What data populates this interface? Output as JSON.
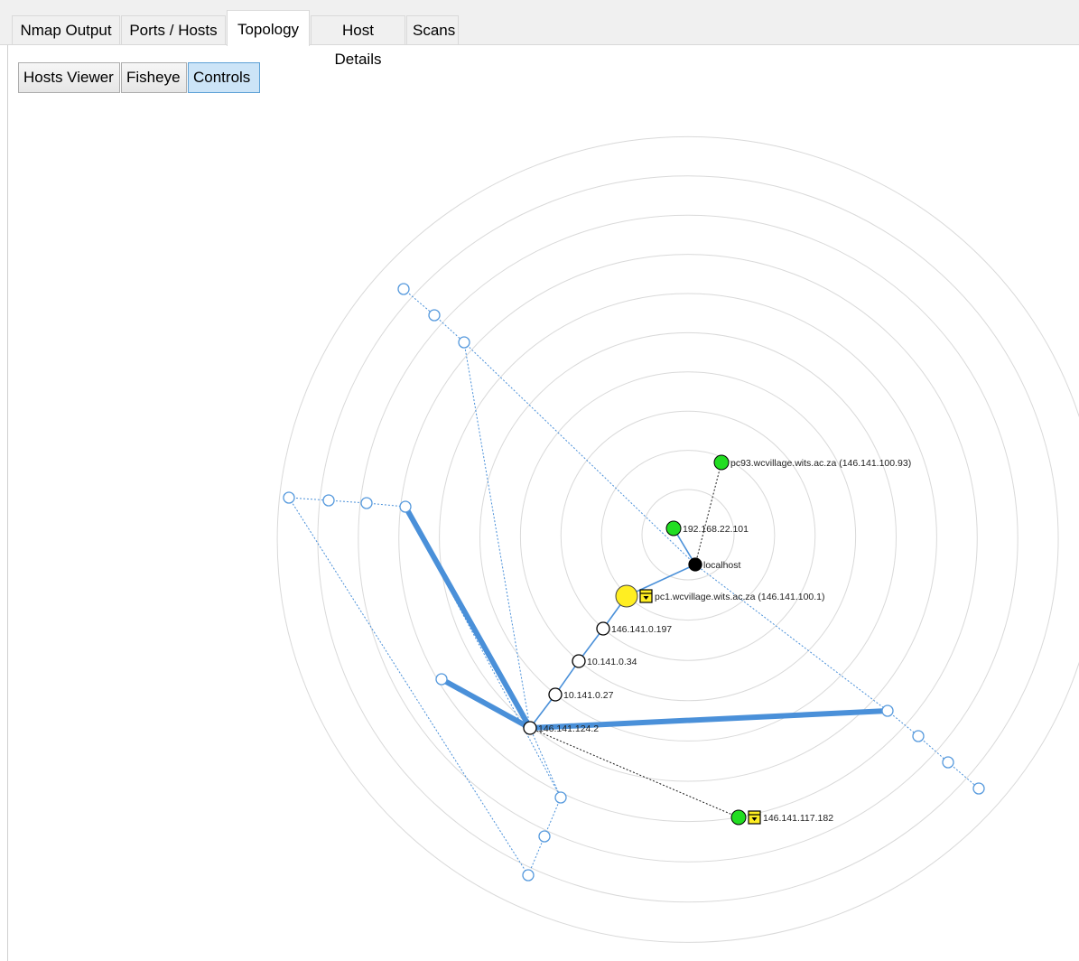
{
  "tabs": [
    {
      "label": "Nmap Output",
      "active": false
    },
    {
      "label": "Ports / Hosts",
      "active": false
    },
    {
      "label": "Topology",
      "active": true
    },
    {
      "label": "Host Details",
      "active": false
    },
    {
      "label": "Scans",
      "active": false
    }
  ],
  "toolbar": {
    "hosts_viewer": "Hosts Viewer",
    "fisheye": "Fisheye",
    "controls": "Controls",
    "controls_pressed": true
  },
  "graph": {
    "rings": 10,
    "colors": {
      "ring": "#d9d9d9",
      "edge": "#4a90d9",
      "unknown_edge": "#1a1a1a",
      "green_host": "#22dd22",
      "yellow_host": "#ffee22",
      "localhost": "#000000",
      "hop": "#ffffff",
      "hidden_hop": "#5599dd"
    },
    "nodes": {
      "localhost": {
        "label": "localhost",
        "type": "localhost"
      },
      "h192": {
        "label": "192.168.22.101",
        "type": "green"
      },
      "pc93": {
        "label": "pc93.wcvillage.wits.ac.za (146.141.100.93)",
        "type": "green"
      },
      "pc1": {
        "label": "pc1.wcvillage.wits.ac.za (146.141.100.1)",
        "type": "yellow",
        "icon": "firewall-icon"
      },
      "h0197": {
        "label": "146.141.0.197",
        "type": "hop"
      },
      "h034": {
        "label": "10.141.0.34",
        "type": "hop"
      },
      "h027": {
        "label": "10.141.0.27",
        "type": "hop"
      },
      "h1242": {
        "label": "146.141.124.2",
        "type": "hop"
      },
      "h117": {
        "label": "146.141.117.182",
        "type": "green",
        "icon": "firewall-icon"
      }
    }
  }
}
